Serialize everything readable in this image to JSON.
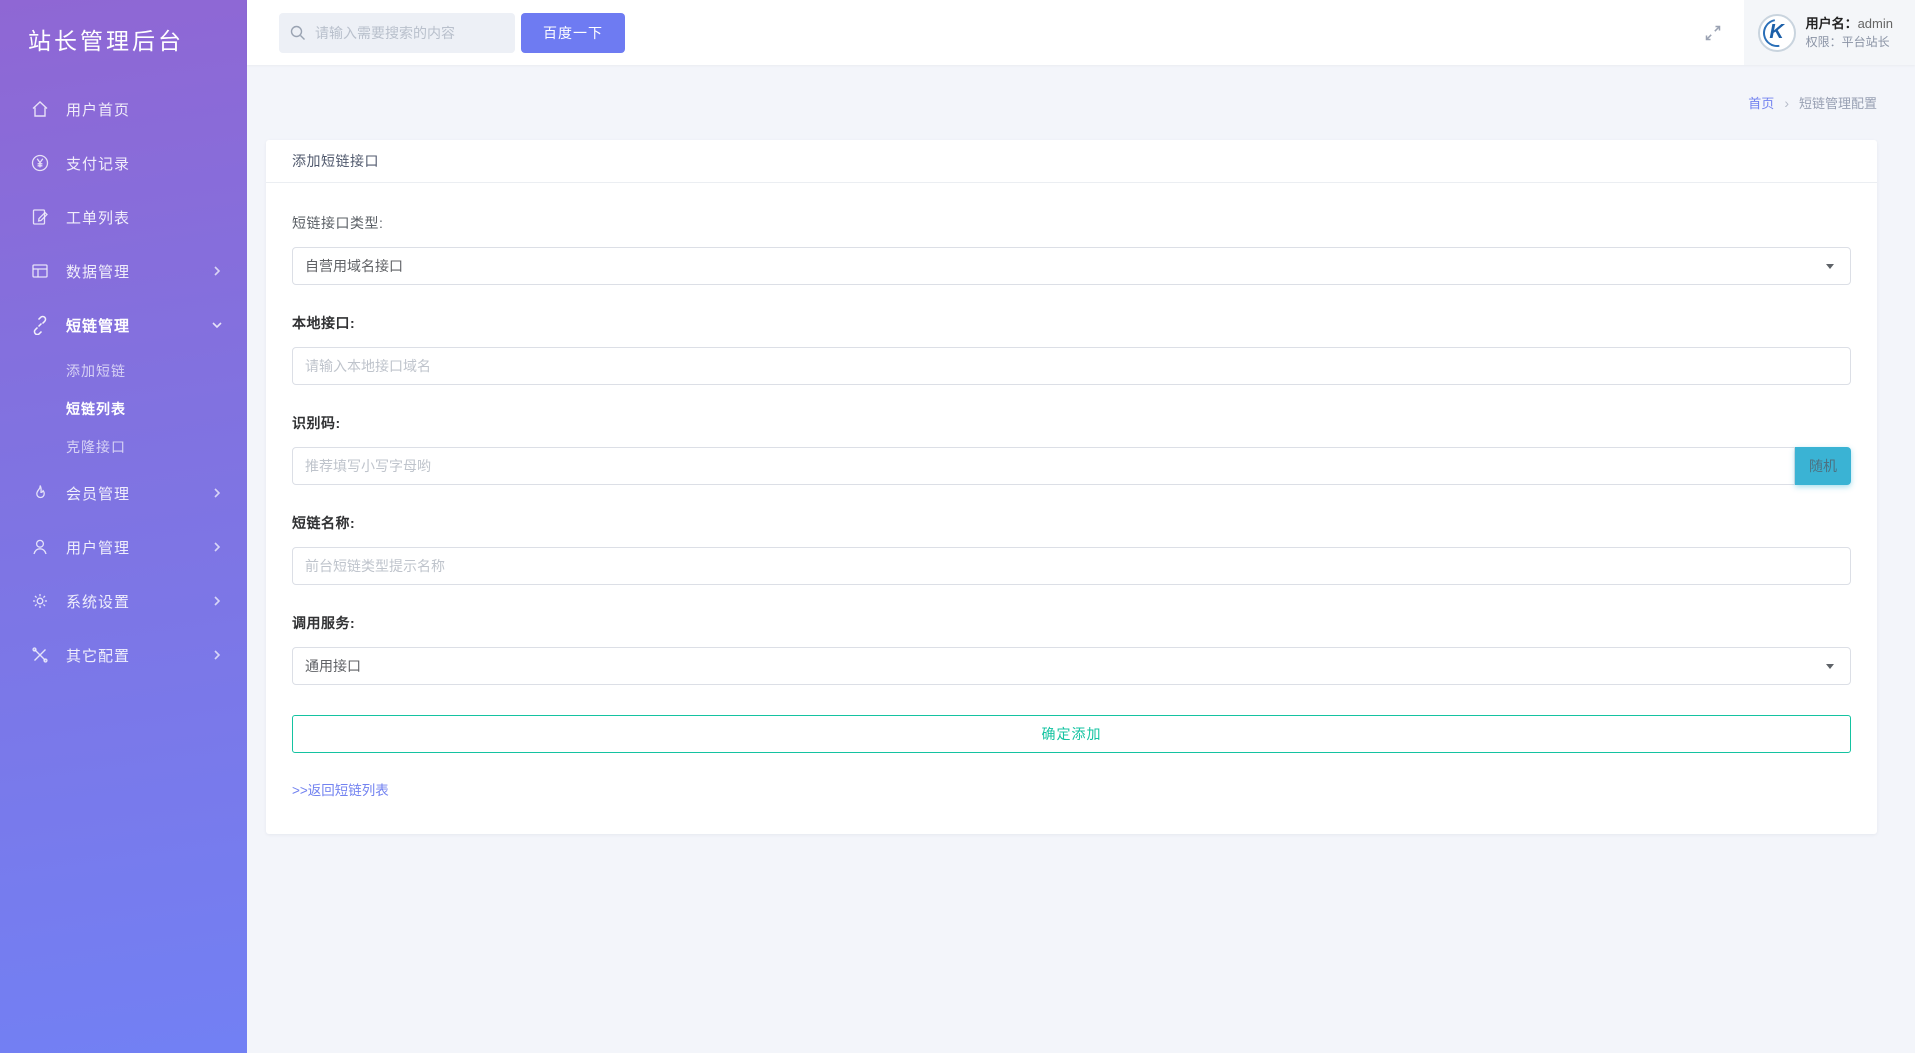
{
  "app": {
    "title": "站长管理后台"
  },
  "topbar": {
    "search": {
      "placeholder": "请输入需要搜索的内容",
      "button_label": "百度一下"
    },
    "user": {
      "name_label": "用户名：",
      "name": "admin",
      "role_label": "权限：",
      "role": "平台站长",
      "avatar_letter": "K"
    }
  },
  "sidebar": {
    "items": [
      {
        "label": "用户首页"
      },
      {
        "label": "支付记录"
      },
      {
        "label": "工单列表"
      },
      {
        "label": "数据管理"
      },
      {
        "label": "短链管理"
      },
      {
        "label": "会员管理"
      },
      {
        "label": "用户管理"
      },
      {
        "label": "系统设置"
      },
      {
        "label": "其它配置"
      }
    ],
    "shortlink_children": [
      {
        "label": "添加短链"
      },
      {
        "label": "短链列表"
      },
      {
        "label": "克隆接口"
      }
    ]
  },
  "breadcrumb": {
    "home": "首页",
    "separator": "›",
    "current": "短链管理配置"
  },
  "panel": {
    "title": "添加短链接口",
    "fields": [
      {
        "label": "短链接口类型:",
        "type": "select",
        "value": "自营用域名接口"
      },
      {
        "label": "本地接口:",
        "type": "input",
        "placeholder": "请输入本地接口域名"
      },
      {
        "label": "识别码:",
        "type": "input-button",
        "placeholder": "推荐填写小写字母哟",
        "button_label": "随机"
      },
      {
        "label": "短链名称:",
        "type": "input",
        "placeholder": "前台短链类型提示名称"
      },
      {
        "label": "调用服务:",
        "type": "select",
        "value": "通用接口"
      }
    ],
    "submit_label": "确定添加",
    "back_link": ">>返回短链列表"
  },
  "colors": {
    "sidebar_top": "#8f67d4",
    "sidebar_bottom": "#7280f4",
    "accent_purple": "#6e7bf2",
    "random_button_teal": "#3ab3d4",
    "submit_green": "#14c3a1",
    "link_blue": "#7282f0",
    "content_bg": "#f3f5fa"
  }
}
